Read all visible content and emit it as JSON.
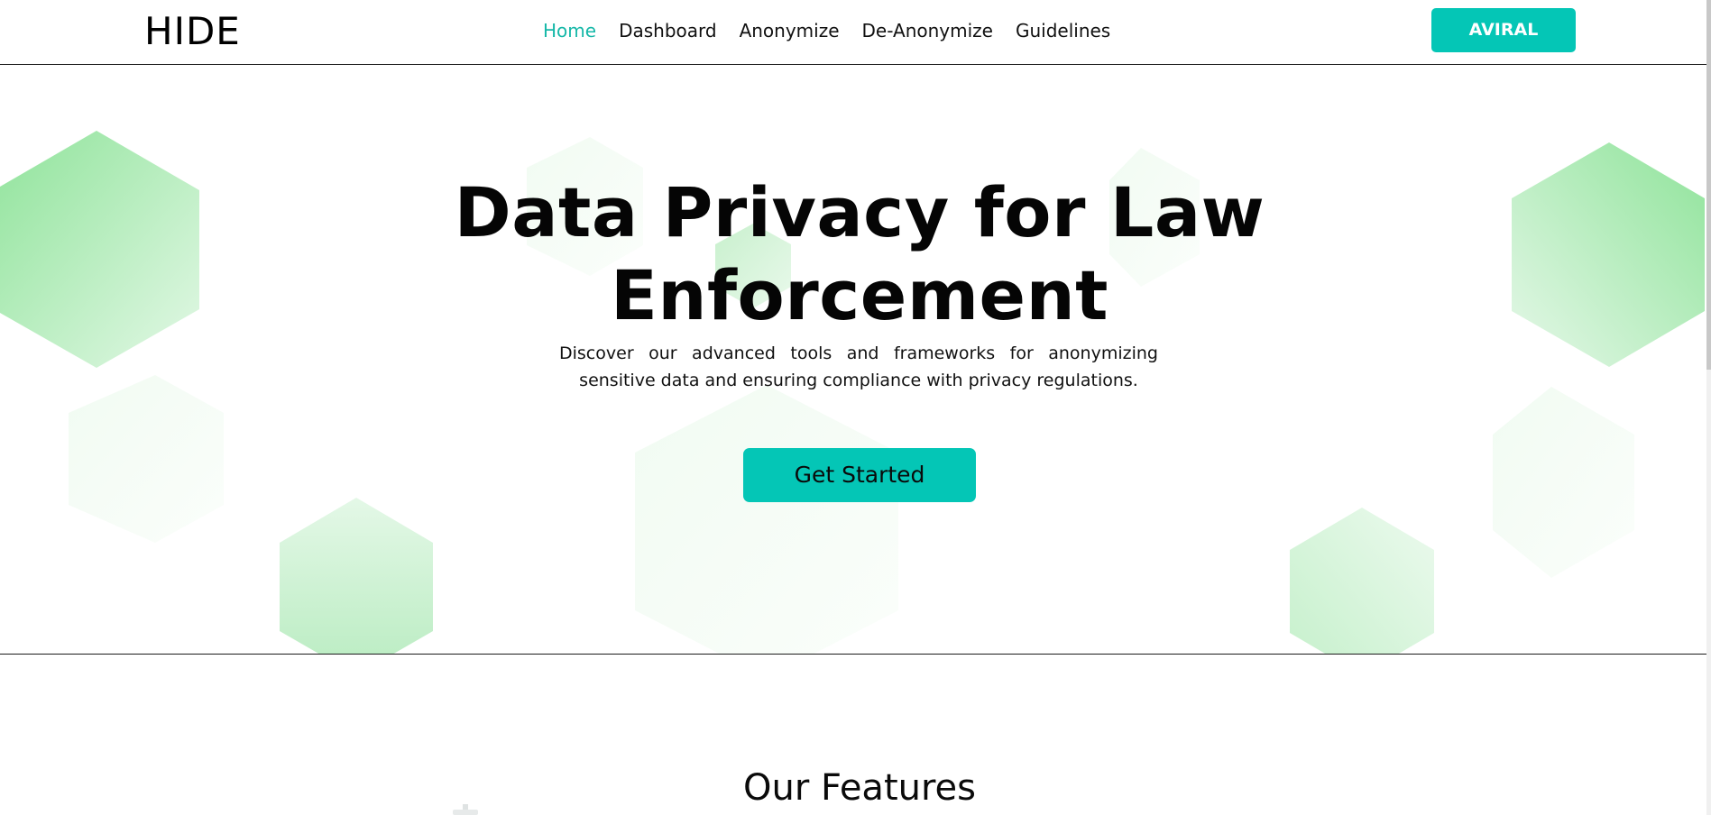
{
  "nav": {
    "logo": "HIDE",
    "links": [
      {
        "label": "Home",
        "active": true
      },
      {
        "label": "Dashboard",
        "active": false
      },
      {
        "label": "Anonymize",
        "active": false
      },
      {
        "label": "De-Anonymize",
        "active": false
      },
      {
        "label": "Guidelines",
        "active": false
      }
    ],
    "user_button": "AVIRAL"
  },
  "hero": {
    "title_line1": "Data Privacy for Law",
    "title_line2": "Enforcement",
    "description": "Discover our advanced tools and frameworks for anonymizing sensitive data and ensuring compliance with privacy regulations.",
    "cta_label": "Get Started"
  },
  "features": {
    "title": "Our Features"
  },
  "colors": {
    "accent": "#04c6b6",
    "active_link": "#16b8a8",
    "hexagon_green": "#8fe39a",
    "divider": "#1b1b1b"
  }
}
